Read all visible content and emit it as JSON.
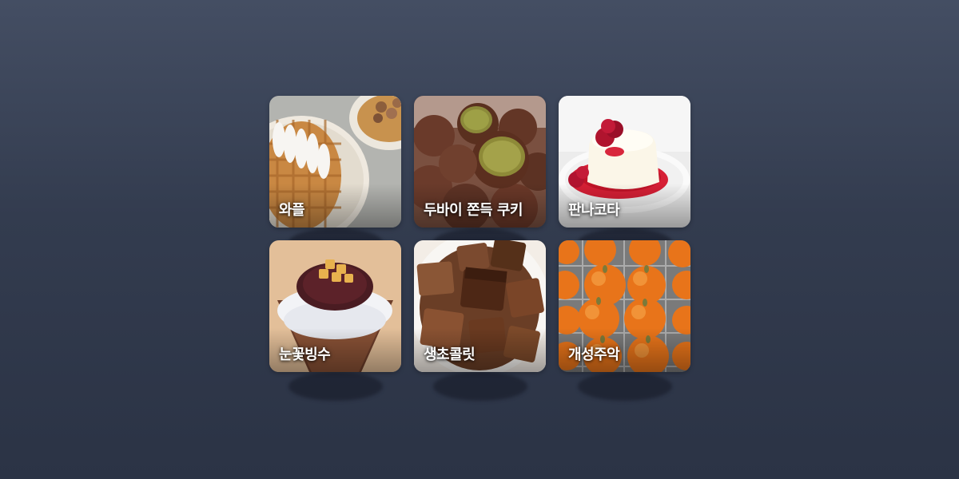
{
  "tiles": [
    {
      "label": "와플",
      "icon": "waffle-image"
    },
    {
      "label": "두바이 쫀득 쿠키",
      "icon": "dubai-cookie-image"
    },
    {
      "label": "판나코타",
      "icon": "panna-cotta-image"
    },
    {
      "label": "눈꽃빙수",
      "icon": "bingsu-image"
    },
    {
      "label": "생초콜릿",
      "icon": "nama-chocolate-image"
    },
    {
      "label": "개성주악",
      "icon": "gaeseong-juak-image"
    }
  ],
  "colors": {
    "background_top": "#444e63",
    "background_bottom": "#2b3345",
    "label_text": "#ffffff"
  }
}
